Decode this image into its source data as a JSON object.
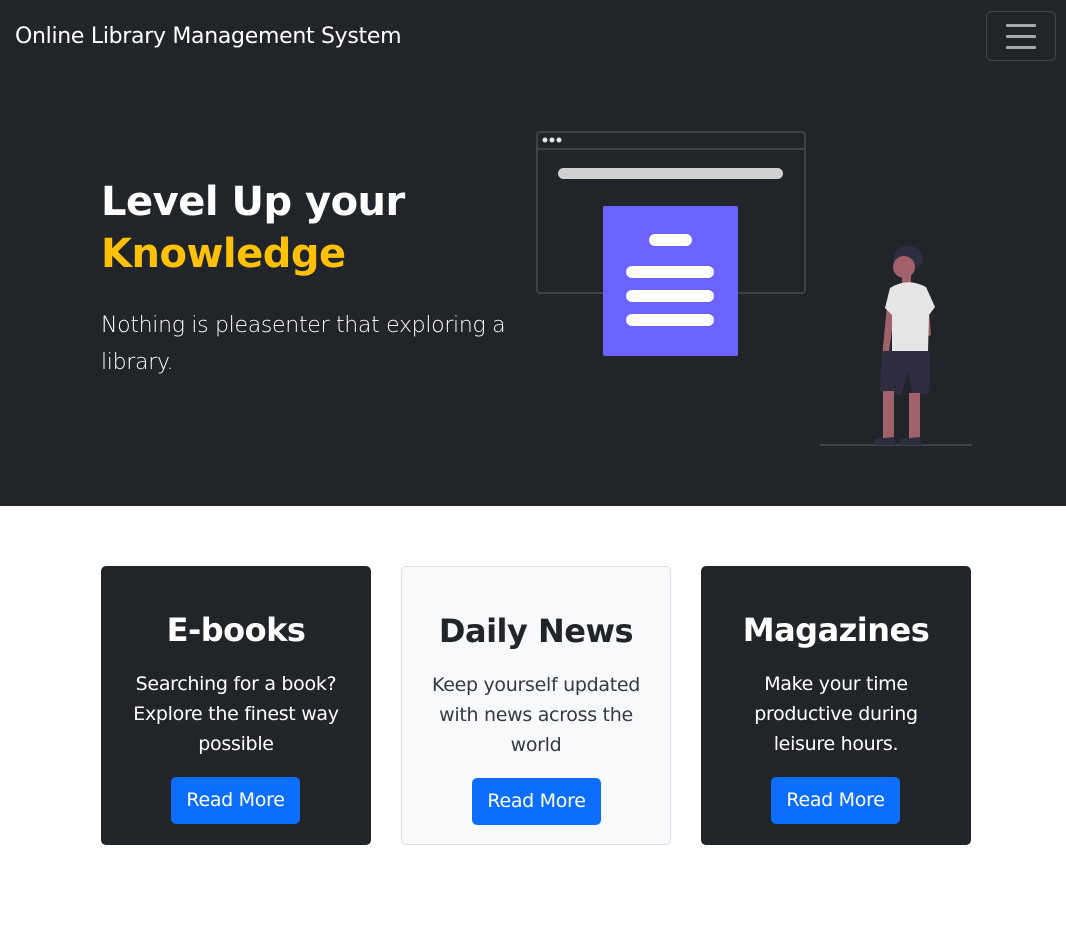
{
  "navbar": {
    "brand": "Online Library Management System",
    "toggler_icon": "hamburger-icon"
  },
  "hero": {
    "title_line1": "Level Up your",
    "title_accent": "Knowledge",
    "subtitle": "Nothing is pleasenter that exploring a library.",
    "accent_color": "#ffc107",
    "illustration": "person-reading-document-illustration"
  },
  "cards": [
    {
      "title": "E-books",
      "text": "Searching for a book? Explore the finest way possible",
      "button": "Read More",
      "theme": "dark"
    },
    {
      "title": "Daily News",
      "text": "Keep yourself updated with news across the world",
      "button": "Read More",
      "theme": "light"
    },
    {
      "title": "Magazines",
      "text": "Make your time productive during leisure hours.",
      "button": "Read More",
      "theme": "dark"
    }
  ],
  "colors": {
    "dark_bg": "#212529",
    "primary_button": "#0d6efd",
    "illustration_purple": "#6c63ff"
  }
}
